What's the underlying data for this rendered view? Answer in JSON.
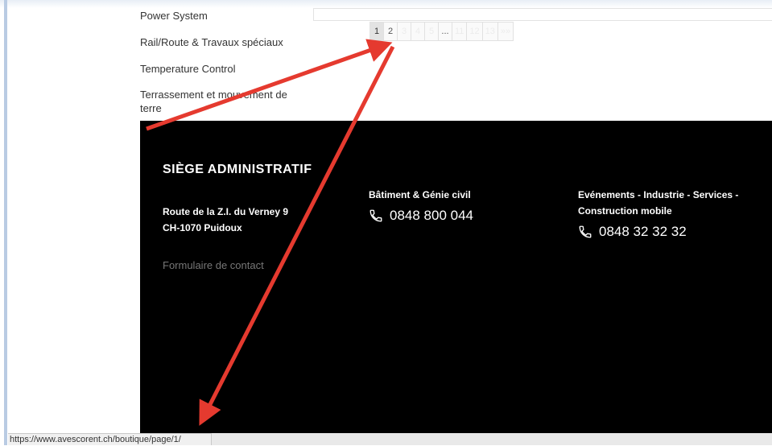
{
  "categories": [
    "Power System",
    "Rail/Route & Travaux spéciaux",
    "Temperature Control",
    "Terrassement et mouvement de",
    "terre"
  ],
  "pagination": [
    "1",
    "2",
    "3",
    "4",
    "5",
    "...",
    "11",
    "12",
    "13",
    "»»"
  ],
  "footer": {
    "title": "SIÈGE ADMINISTRATIF",
    "address_line1": "Route de la Z.I. du Verney 9",
    "address_line2": "CH-1070 Puidoux",
    "contact_link": "Formulaire de contact",
    "col1_heading": "Bâtiment & Génie civil",
    "col1_phone": "0848 800 044",
    "col2_heading_line1": "Evénements - Industrie - Services -",
    "col2_heading_line2": "Construction mobile",
    "col2_phone": "0848 32 32 32"
  },
  "status_url": "https://www.avescorent.ch/boutique/page/1/",
  "colors": {
    "footer_bg": "#000000",
    "arrow": "#e53a2f"
  },
  "icons": [
    "phone-icon"
  ]
}
